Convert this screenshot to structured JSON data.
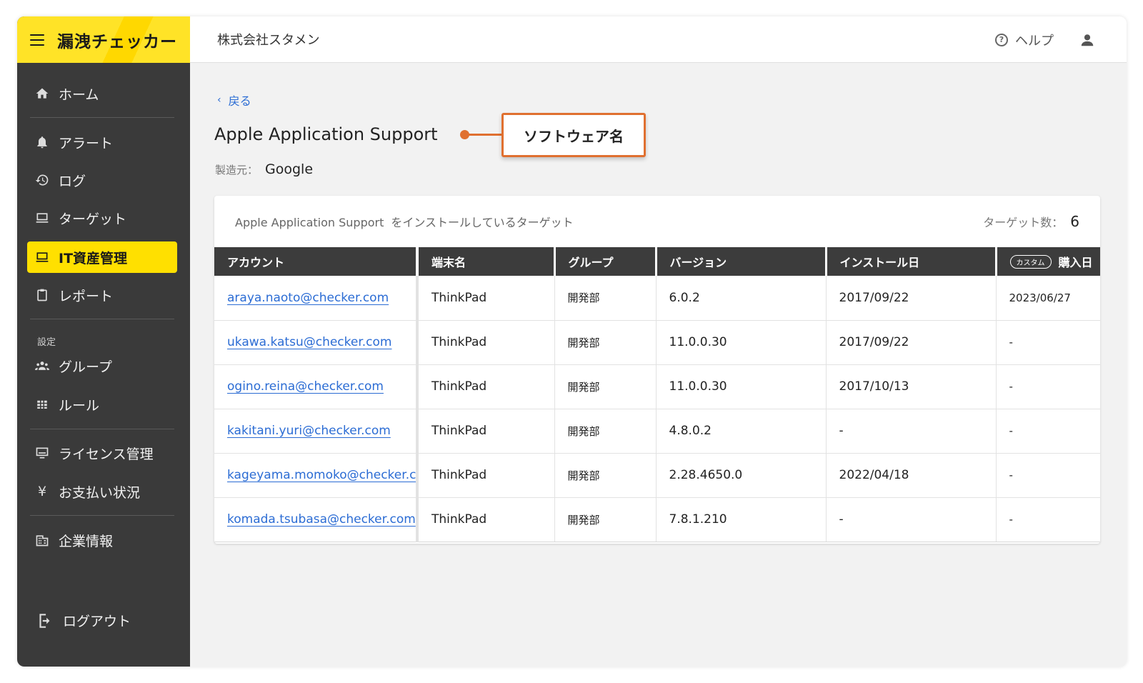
{
  "brand": {
    "name": "漏洩チェッカー"
  },
  "header": {
    "company": "株式会社スタメン",
    "help_label": "ヘルプ"
  },
  "sidebar": {
    "items": [
      {
        "label": "ホーム"
      },
      {
        "label": "アラート"
      },
      {
        "label": "ログ"
      },
      {
        "label": "ターゲット"
      },
      {
        "label": "IT資産管理"
      },
      {
        "label": "レポート"
      },
      {
        "label": "グループ"
      },
      {
        "label": "ルール"
      },
      {
        "label": "ライセンス管理"
      },
      {
        "label": "お支払い状況"
      },
      {
        "label": "企業情報"
      }
    ],
    "section_label": "設定",
    "logout_label": "ログアウト"
  },
  "main": {
    "back_label": "戻る",
    "software_name": "Apple Application Support",
    "callout_label": "ソフトウェア名",
    "maker_label": "製造元：",
    "maker_value": "Google",
    "card": {
      "title_name": "Apple Application Support",
      "title_suffix": "をインストールしているターゲット",
      "target_count_label": "ターゲット数：",
      "target_count": "6"
    },
    "table": {
      "headers": {
        "account": "アカウント",
        "device": "端末名",
        "group": "グループ",
        "version": "バージョン",
        "install_date": "インストール日",
        "custom_tag": "カスタム",
        "purchase_date": "購入日"
      },
      "rows": [
        {
          "account": "araya.naoto@checker.com",
          "device": "ThinkPad",
          "group": "開発部",
          "version": "6.0.2",
          "install_date": "2017/09/22",
          "purchase_date": "2023/06/27"
        },
        {
          "account": "ukawa.katsu@checker.com",
          "device": "ThinkPad",
          "group": "開発部",
          "version": "11.0.0.30",
          "install_date": "2017/09/22",
          "purchase_date": "-"
        },
        {
          "account": "ogino.reina@checker.com",
          "device": "ThinkPad",
          "group": "開発部",
          "version": "11.0.0.30",
          "install_date": "2017/10/13",
          "purchase_date": "-"
        },
        {
          "account": "kakitani.yuri@checker.com",
          "device": "ThinkPad",
          "group": "開発部",
          "version": "4.8.0.2",
          "install_date": "-",
          "purchase_date": "-"
        },
        {
          "account": "kageyama.momoko@checker.com",
          "device": "ThinkPad",
          "group": "開発部",
          "version": "2.28.4650.0",
          "install_date": "2022/04/18",
          "purchase_date": "-"
        },
        {
          "account": "komada.tsubasa@checker.com",
          "device": "ThinkPad",
          "group": "開発部",
          "version": "7.8.1.210",
          "install_date": "-",
          "purchase_date": "-"
        }
      ]
    }
  },
  "colors": {
    "accent": "#ffe000",
    "sidebar_bg": "#3a3a3a",
    "link": "#2b6cd4",
    "callout": "#e07030"
  },
  "icons": [
    "menu-icon",
    "home-icon",
    "bell-icon",
    "history-icon",
    "laptop-icon",
    "clipboard-icon",
    "people-icon",
    "grid-icon",
    "monitor-icon",
    "yen-icon",
    "building-icon",
    "logout-icon",
    "help-icon",
    "user-icon",
    "chevron-left-icon"
  ]
}
